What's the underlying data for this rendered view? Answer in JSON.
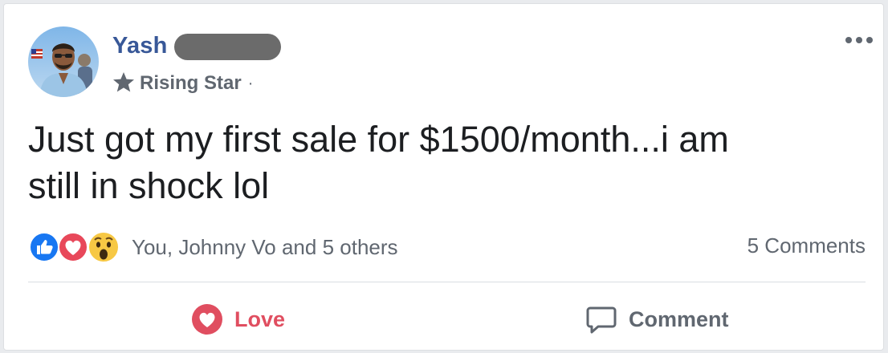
{
  "post": {
    "author_name": "Yash",
    "badge_label": "Rising Star",
    "badge_separator": "·",
    "text": "Just got my first sale for $1500/month...i am\nstill in shock lol"
  },
  "reactions": {
    "icons": [
      "like-icon",
      "love-icon",
      "wow-icon"
    ],
    "summary": "You, Johnny Vo and 5 others"
  },
  "comments": {
    "count_label": "5 Comments"
  },
  "actions": {
    "love_label": "Love",
    "comment_label": "Comment"
  },
  "colors": {
    "author": "#385898",
    "secondary_text": "#606770",
    "love": "#e04e60",
    "like": "#1877f2",
    "divider": "#dadde1"
  }
}
